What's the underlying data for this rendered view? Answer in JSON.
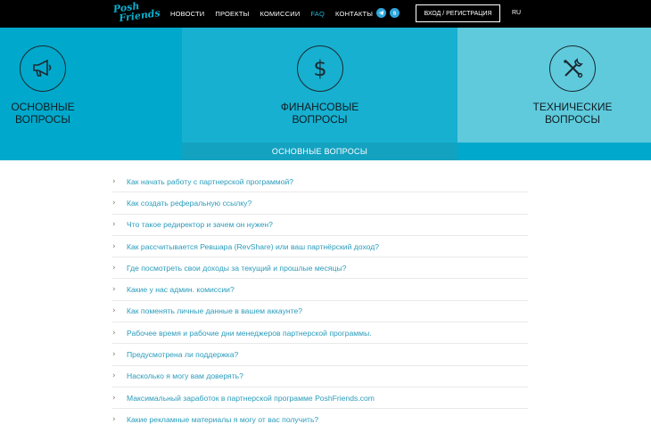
{
  "header": {
    "logo_line1": "Posh",
    "logo_line2": "Friends",
    "nav": [
      "НОВОСТИ",
      "ПРОЕКТЫ",
      "КОМИССИИ",
      "FAQ",
      "КОНТАКТЫ"
    ],
    "active_nav": "FAQ",
    "login_label": "ВХОД / РЕГИСТРАЦИЯ",
    "language": "RU"
  },
  "tiles": [
    {
      "line1": "ОСНОВНЫЕ",
      "line2": "ВОПРОСЫ",
      "icon": "megaphone-icon"
    },
    {
      "line1": "ФИНАНСОВЫЕ",
      "line2": "ВОПРОСЫ",
      "icon": "dollar-icon"
    },
    {
      "line1": "ТЕХНИЧЕСКИЕ",
      "line2": "ВОПРОСЫ",
      "icon": "tools-icon"
    }
  ],
  "section_title": "ОСНОВНЫЕ ВОПРОСЫ",
  "questions": [
    "Как начать работу с партнерской программой?",
    "Как создать реферальную ссылку?",
    "Что такое редиректор и зачем он нужен?",
    "Как рассчитывается Ревшара (RevShare) или ваш партнёрский доход?",
    "Где посмотреть свои доходы за текущий и прошлые месяцы?",
    "Какие у нас админ. комиссии?",
    "Как поменять личные данные в вашем аккаунте?",
    "Рабочее время и рабочие дни менеджеров партнерской программы.",
    "Предусмотрена ли поддержка?",
    "Насколько я могу вам доверять?",
    "Максимальный заработок в партнерской программе PoshFriends.com",
    "Какие рекламные материалы я могу от вас получить?"
  ],
  "colors": {
    "header_bg": "#000000",
    "accent": "#00a9cc",
    "link": "#2a9cbb",
    "active_nav": "#25b7d3"
  }
}
